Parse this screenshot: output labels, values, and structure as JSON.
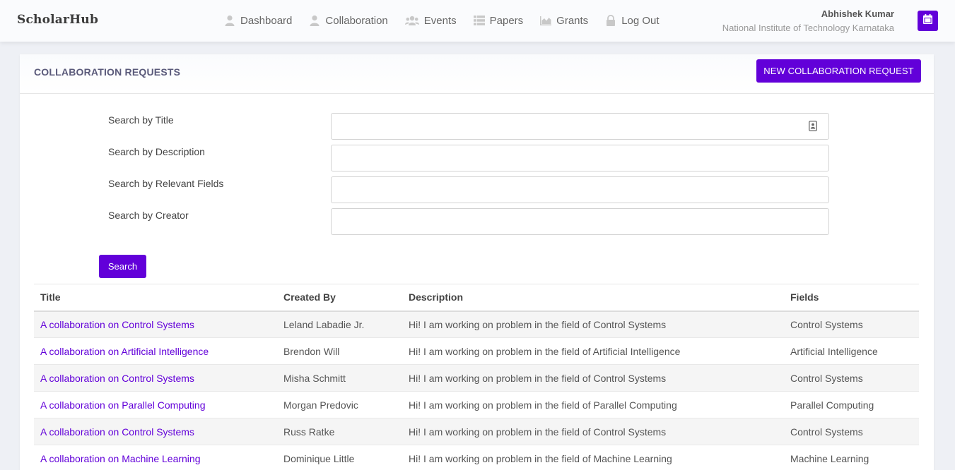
{
  "nav": {
    "brand": "ScholarHub",
    "items": [
      {
        "label": "Dashboard",
        "icon": "user-icon"
      },
      {
        "label": "Collaboration",
        "icon": "user-icon"
      },
      {
        "label": "Events",
        "icon": "users-icon"
      },
      {
        "label": "Papers",
        "icon": "list-icon"
      },
      {
        "label": "Grants",
        "icon": "chart-icon"
      },
      {
        "label": "Log Out",
        "icon": "lock-icon"
      }
    ],
    "user_name": "Abhishek Kumar",
    "user_institution": "National Institute of Technology Karnataka",
    "calendar_icon": "calendar-icon"
  },
  "colors": {
    "accent": "#6200d9",
    "link": "#6200d9"
  },
  "page": {
    "title": "COLLABORATION REQUESTS",
    "new_button": "NEW COLLABORATION REQUEST"
  },
  "search": {
    "title_label": "Search by Title",
    "title_value": "",
    "description_label": "Search by Description",
    "description_value": "",
    "fields_label": "Search by Relevant Fields",
    "fields_value": "",
    "creator_label": "Search by Creator",
    "creator_value": "",
    "button": "Search"
  },
  "table": {
    "headers": [
      "Title",
      "Created By",
      "Description",
      "Fields"
    ],
    "rows": [
      [
        "A collaboration on Control Systems",
        "Leland Labadie Jr.",
        "Hi! I am working on problem in the field of Control Systems",
        "Control Systems"
      ],
      [
        "A collaboration on Artificial Intelligence",
        "Brendon Will",
        "Hi! I am working on problem in the field of Artificial Intelligence",
        "Artificial Intelligence"
      ],
      [
        "A collaboration on Control Systems",
        "Misha Schmitt",
        "Hi! I am working on problem in the field of Control Systems",
        "Control Systems"
      ],
      [
        "A collaboration on Parallel Computing",
        "Morgan Predovic",
        "Hi! I am working on problem in the field of Parallel Computing",
        "Parallel Computing"
      ],
      [
        "A collaboration on Control Systems",
        "Russ Ratke",
        "Hi! I am working on problem in the field of Control Systems",
        "Control Systems"
      ],
      [
        "A collaboration on Machine Learning",
        "Dominique Little",
        "Hi! I am working on problem in the field of Machine Learning",
        "Machine Learning"
      ]
    ]
  }
}
